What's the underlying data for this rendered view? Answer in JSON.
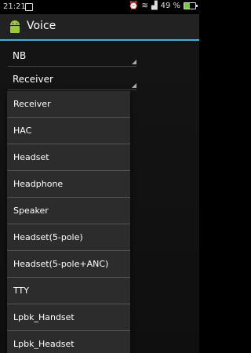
{
  "status_bar": {
    "time": "21:21",
    "battery": "49 %",
    "battery_level_percent": 49
  },
  "action_bar": {
    "title": "Voice"
  },
  "spinners": [
    {
      "value": "NB"
    },
    {
      "value": "Receiver"
    }
  ],
  "dropdown": {
    "items": [
      "Receiver",
      "HAC",
      "Headset",
      "Headphone",
      "Speaker",
      "Headset(5-pole)",
      "Headset(5-pole+ANC)",
      "TTY",
      "Lpbk_Handset",
      "Lpbk_Headset"
    ]
  }
}
